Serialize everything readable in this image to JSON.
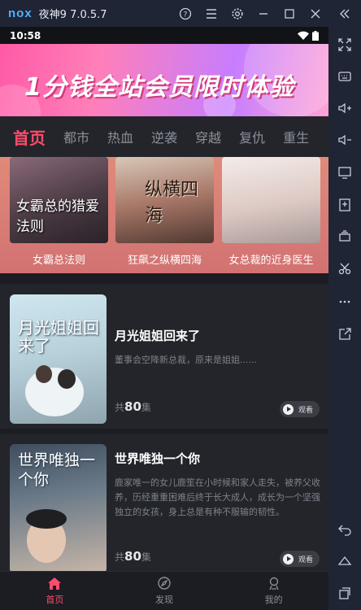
{
  "window": {
    "logo": "nox",
    "title": "夜神9 7.0.5.7",
    "controls": [
      "help-icon",
      "menu-icon",
      "settings-icon",
      "minimize-icon",
      "maximize-icon",
      "close-icon",
      "collapse-icon"
    ]
  },
  "status": {
    "time": "10:58"
  },
  "banner": {
    "text": "1分钱全站会员限时体验"
  },
  "tabs": [
    {
      "label": "首页",
      "active": true
    },
    {
      "label": "都市"
    },
    {
      "label": "热血"
    },
    {
      "label": "逆袭"
    },
    {
      "label": "穿越"
    },
    {
      "label": "复仇"
    },
    {
      "label": "重生"
    }
  ],
  "featured": [
    {
      "title": "女霸总法则",
      "cover_text": "女霸总的猎爱法则"
    },
    {
      "title": "狂飙之纵横四海",
      "cover_text": "纵横四海"
    },
    {
      "title": "女总裁的近身医生",
      "cover_text": ""
    }
  ],
  "dramas": [
    {
      "title": "月光姐姐回来了",
      "description": "董事会空降新总裁，原来是姐姐......",
      "count_prefix": "共",
      "count": "80",
      "count_suffix": "集",
      "watch": "观看",
      "cover_text": "月光姐姐回来了"
    },
    {
      "title": "世界唯独一个你",
      "description": "鹿家唯一的女儿鹿笙在小时候和家人走失，被养父收养，历经重重困难后终于长大成人，成长为一个坚强独立的女孩，身上总是有种不服输的韧性。",
      "count_prefix": "共",
      "count": "80",
      "count_suffix": "集",
      "watch": "观看",
      "cover_text": "世界唯独一个你"
    }
  ],
  "bottom_nav": [
    {
      "label": "首页",
      "active": true
    },
    {
      "label": "发现"
    },
    {
      "label": "我的"
    }
  ],
  "colors": {
    "accent": "#ff4b6b",
    "chrome": "#1f2535",
    "background": "#1b1d22",
    "card": "#23252b"
  }
}
